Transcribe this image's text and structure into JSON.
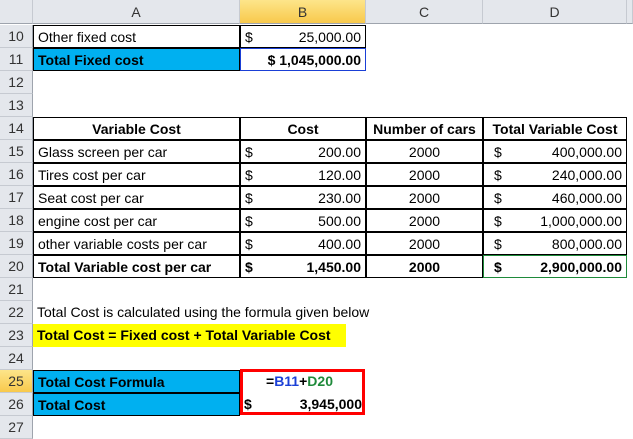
{
  "columns": [
    "A",
    "B",
    "C",
    "D"
  ],
  "rows": {
    "r10": {
      "num": "10",
      "a": "Other fixed cost",
      "b_cur": "$",
      "b": "25,000.00"
    },
    "r11": {
      "num": "11",
      "a": "Total Fixed cost",
      "b": "$ 1,045,000.00"
    },
    "r12": {
      "num": "12"
    },
    "r13": {
      "num": "13"
    },
    "r14": {
      "num": "14",
      "a": "Variable Cost",
      "b": "Cost",
      "c": "Number of cars",
      "d": "Total Variable Cost"
    },
    "r15": {
      "num": "15",
      "a": "Glass screen per car",
      "b_cur": "$",
      "b": "200.00",
      "c": "2000",
      "d_cur": "$",
      "d": "400,000.00"
    },
    "r16": {
      "num": "16",
      "a": "Tires cost per car",
      "b_cur": "$",
      "b": "120.00",
      "c": "2000",
      "d_cur": "$",
      "d": "240,000.00"
    },
    "r17": {
      "num": "17",
      "a": "Seat cost per car",
      "b_cur": "$",
      "b": "230.00",
      "c": "2000",
      "d_cur": "$",
      "d": "460,000.00"
    },
    "r18": {
      "num": "18",
      "a": "engine cost per car",
      "b_cur": "$",
      "b": "500.00",
      "c": "2000",
      "d_cur": "$",
      "d": "1,000,000.00"
    },
    "r19": {
      "num": "19",
      "a": "other variable costs per car",
      "b_cur": "$",
      "b": "400.00",
      "c": "2000",
      "d_cur": "$",
      "d": "800,000.00"
    },
    "r20": {
      "num": "20",
      "a": "Total Variable cost per car",
      "b_cur": "$",
      "b": "1,450.00",
      "c": "2000",
      "d_cur": "$",
      "d": "2,900,000.00"
    },
    "r21": {
      "num": "21"
    },
    "r22": {
      "num": "22",
      "a": "Total Cost is calculated using the formula given below"
    },
    "r23": {
      "num": "23",
      "a": "Total Cost = Fixed cost + Total Variable Cost"
    },
    "r24": {
      "num": "24"
    },
    "r25": {
      "num": "25",
      "a": "Total Cost Formula",
      "f_eq": "=",
      "f_ref1": "B11",
      "f_plus": "+",
      "f_ref2": "D20"
    },
    "r26": {
      "num": "26",
      "a": "Total Cost",
      "b_cur": "$",
      "b": "3,945,000"
    },
    "r27": {
      "num": "27"
    }
  },
  "colors": {
    "header_fill": "#00b0f0",
    "highlight": "#ffff00",
    "formula_box": "#ff0000"
  }
}
